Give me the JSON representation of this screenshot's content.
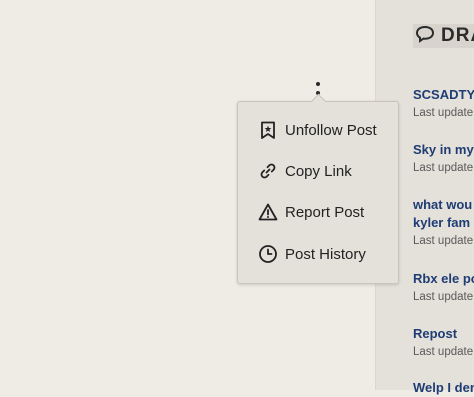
{
  "sidebar": {
    "header": "DRA",
    "posts": [
      {
        "title": "SCSADTY",
        "meta": "Last update"
      },
      {
        "title": "Sky in my",
        "meta": "Last update"
      },
      {
        "title": "what wou",
        "title2": "kyler fam",
        "meta": "Last update"
      },
      {
        "title": "Rbx ele po",
        "meta": "Last update"
      },
      {
        "title": "Repost",
        "meta": "Last update"
      },
      {
        "title": "Welp I den"
      }
    ]
  },
  "menu": {
    "items": [
      {
        "label": "Unfollow Post",
        "icon": "bookmark-icon"
      },
      {
        "label": "Copy Link",
        "icon": "link-icon"
      },
      {
        "label": "Report Post",
        "icon": "warning-icon"
      },
      {
        "label": "Post History",
        "icon": "clock-icon"
      }
    ]
  }
}
